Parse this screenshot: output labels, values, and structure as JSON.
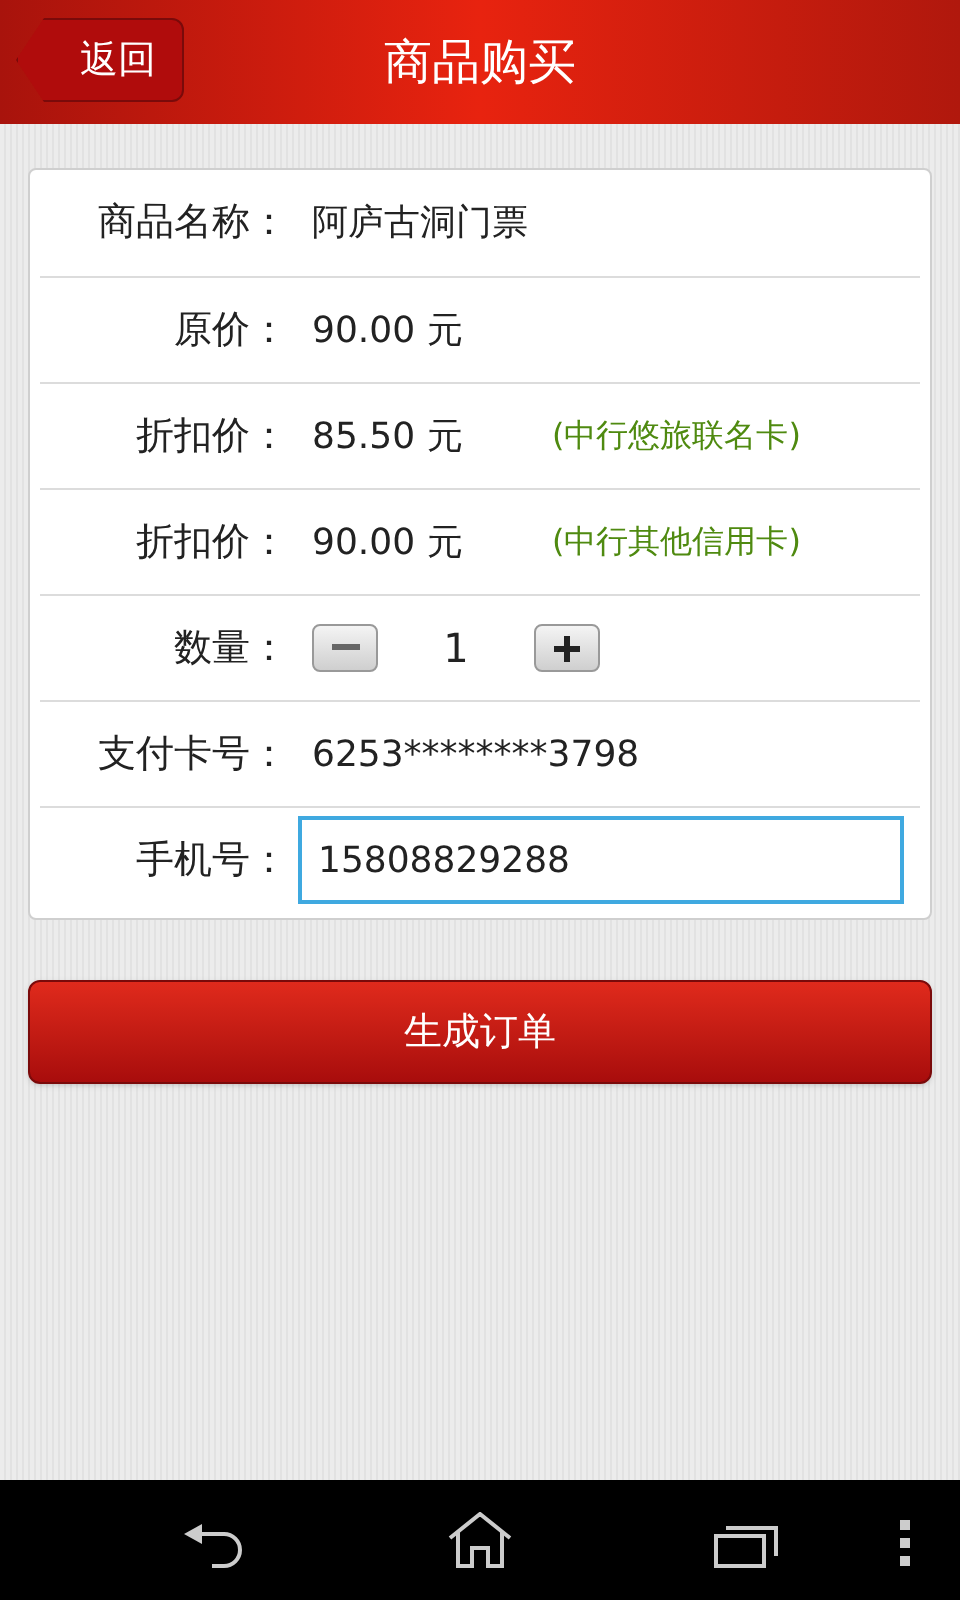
{
  "header": {
    "back": "返回",
    "title": "商品购买"
  },
  "rows": [
    {
      "kind": "text",
      "label": "商品名称：",
      "value": "阿庐古洞门票"
    },
    {
      "kind": "text",
      "label": "原价：",
      "value": "90.00 元"
    },
    {
      "kind": "note",
      "label": "折扣价：",
      "value": "85.50 元",
      "note": "(中行悠旅联名卡)"
    },
    {
      "kind": "note",
      "label": "折扣价：",
      "value": "90.00 元",
      "note": "(中行其他信用卡)"
    },
    {
      "kind": "stepper",
      "label": "数量：",
      "value": "1"
    },
    {
      "kind": "text",
      "label": "支付卡号：",
      "value": "6253********3798"
    },
    {
      "kind": "input",
      "label": "手机号：",
      "value": "15808829288"
    }
  ],
  "submit": "生成订单"
}
